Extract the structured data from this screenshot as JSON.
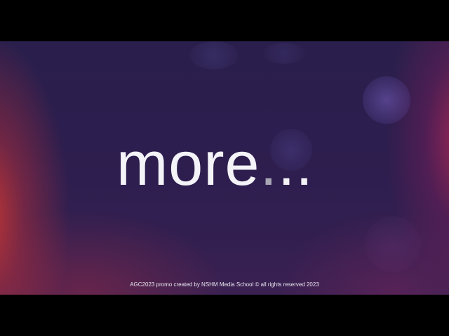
{
  "screen": {
    "headline": {
      "word": "more",
      "first_dot": ".",
      "remaining_dots": ".."
    },
    "credit": "AGC2023 promo created by NSHM Media School © all rights reserved 2023"
  },
  "colors": {
    "letterbox": "#000000",
    "background_indigo": "#2c1e4e",
    "edge_glow_left": "#c83732",
    "edge_glow_right": "#af2855",
    "headline_text": "#f4f3f8",
    "highlighted_dot": "#a8a6b4"
  }
}
